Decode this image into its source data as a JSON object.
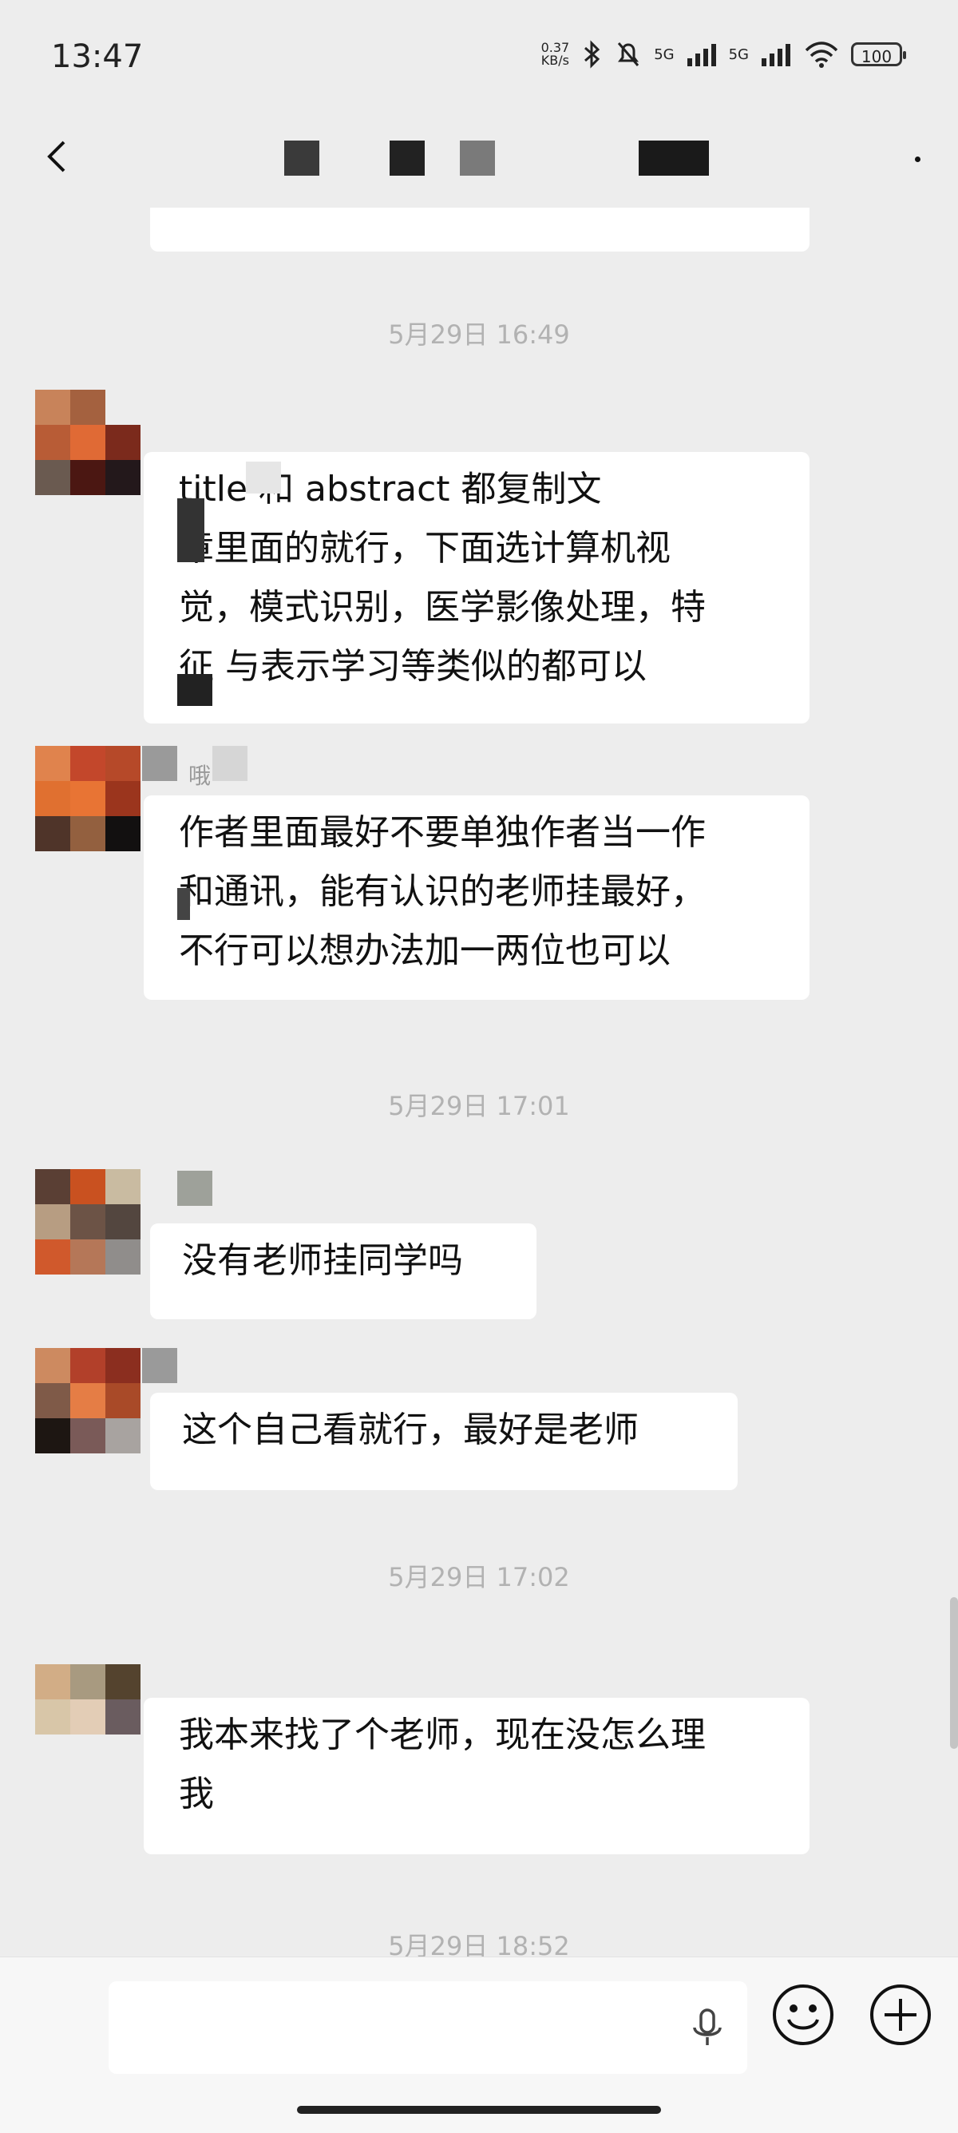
{
  "status_bar": {
    "time": "13:47",
    "net_speed_value": "0.37",
    "net_speed_unit": "KB/s",
    "signal1_label": "5G",
    "signal2_label": "5G",
    "battery": "100"
  },
  "header": {
    "back_icon": "chevron-left-icon",
    "more_icon": "more-dot-icon"
  },
  "messages": [
    {
      "type": "timestamp",
      "text": "5月29日 16:49"
    },
    {
      "type": "incoming",
      "lines": [
        "title 和 abstract 都复制文",
        "章里面的就行，下面选计算机视",
        "觉，模式识别，医学影像处理，特",
        "征  与表示学习等类似的都可以"
      ]
    },
    {
      "type": "incoming",
      "nickname": "哦",
      "lines": [
        "作者里面最好不要单独作者当一作",
        "和通讯，能有认识的老师挂最好，",
        "不行可以想办法加一两位也可以"
      ]
    },
    {
      "type": "timestamp",
      "text": "5月29日 17:01"
    },
    {
      "type": "incoming",
      "lines": [
        "没有老师挂同学吗"
      ]
    },
    {
      "type": "incoming",
      "lines": [
        "这个自己看就行，最好是老师"
      ]
    },
    {
      "type": "timestamp",
      "text": "5月29日 17:02"
    },
    {
      "type": "incoming",
      "lines": [
        "我本来找了个老师，现在没怎么理",
        "我"
      ]
    },
    {
      "type": "timestamp",
      "text": "5月29日 18:52"
    }
  ],
  "input_bar": {
    "mic_icon": "microphone-icon",
    "emoji_icon": "emoji-smile-icon",
    "plus_icon": "plus-circle-icon"
  }
}
